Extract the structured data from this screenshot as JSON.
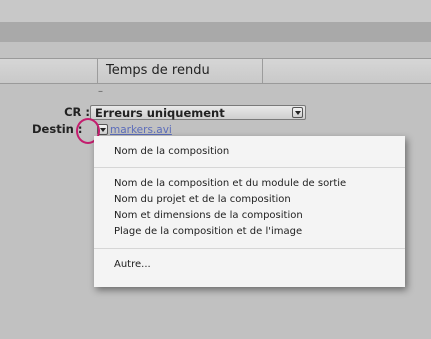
{
  "header": {
    "column_title": "Temps de rendu"
  },
  "rows": {
    "cr": {
      "label": "CR :",
      "value": "Erreurs uniquement"
    },
    "destination": {
      "label": "Destin :",
      "value": "markers.avi"
    }
  },
  "menu": {
    "items": [
      "Nom de la composition",
      "Nom de la composition et du module de sortie",
      "Nom du projet et de la composition",
      "Nom et dimensions de la composition",
      "Plage de la composition et de l'image",
      "Autre..."
    ]
  },
  "colors": {
    "highlight": "#c41d6e",
    "link": "#5c6dbb"
  }
}
